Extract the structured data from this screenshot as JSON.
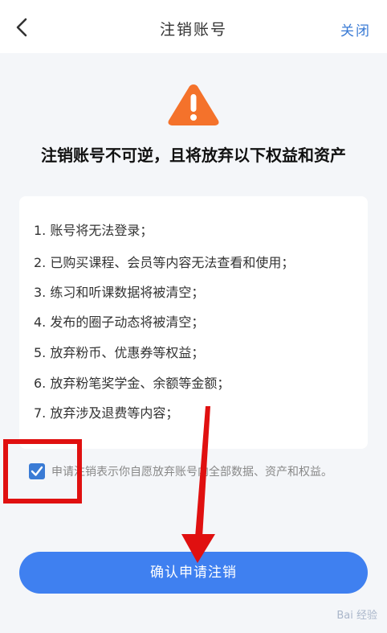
{
  "header": {
    "title": "注销账号",
    "close_label": "关闭"
  },
  "warning": {
    "icon": "warning-triangle-icon",
    "heading": "注销账号不可逆，且将放弃以下权益和资产",
    "color": "#f4722b"
  },
  "consequences": [
    "1. 账号将无法登录；",
    "2. 已购买课程、会员等内容无法查看和使用；",
    "3. 练习和听课数据将被清空；",
    "4. 发布的圈子动态将被清空；",
    "5. 放弃粉币、优惠券等权益；",
    "6. 放弃粉笔奖学金、余额等金额；",
    "7. 放弃涉及退费等内容；"
  ],
  "agreement": {
    "checked": true,
    "text": "申请注销表示你自愿放弃账号内全部数据、资产和权益。"
  },
  "confirm_button": {
    "label": "确认申请注销"
  },
  "watermark": "Bai 经验",
  "colors": {
    "accent": "#3f80f0",
    "annotation": "#e01010"
  }
}
